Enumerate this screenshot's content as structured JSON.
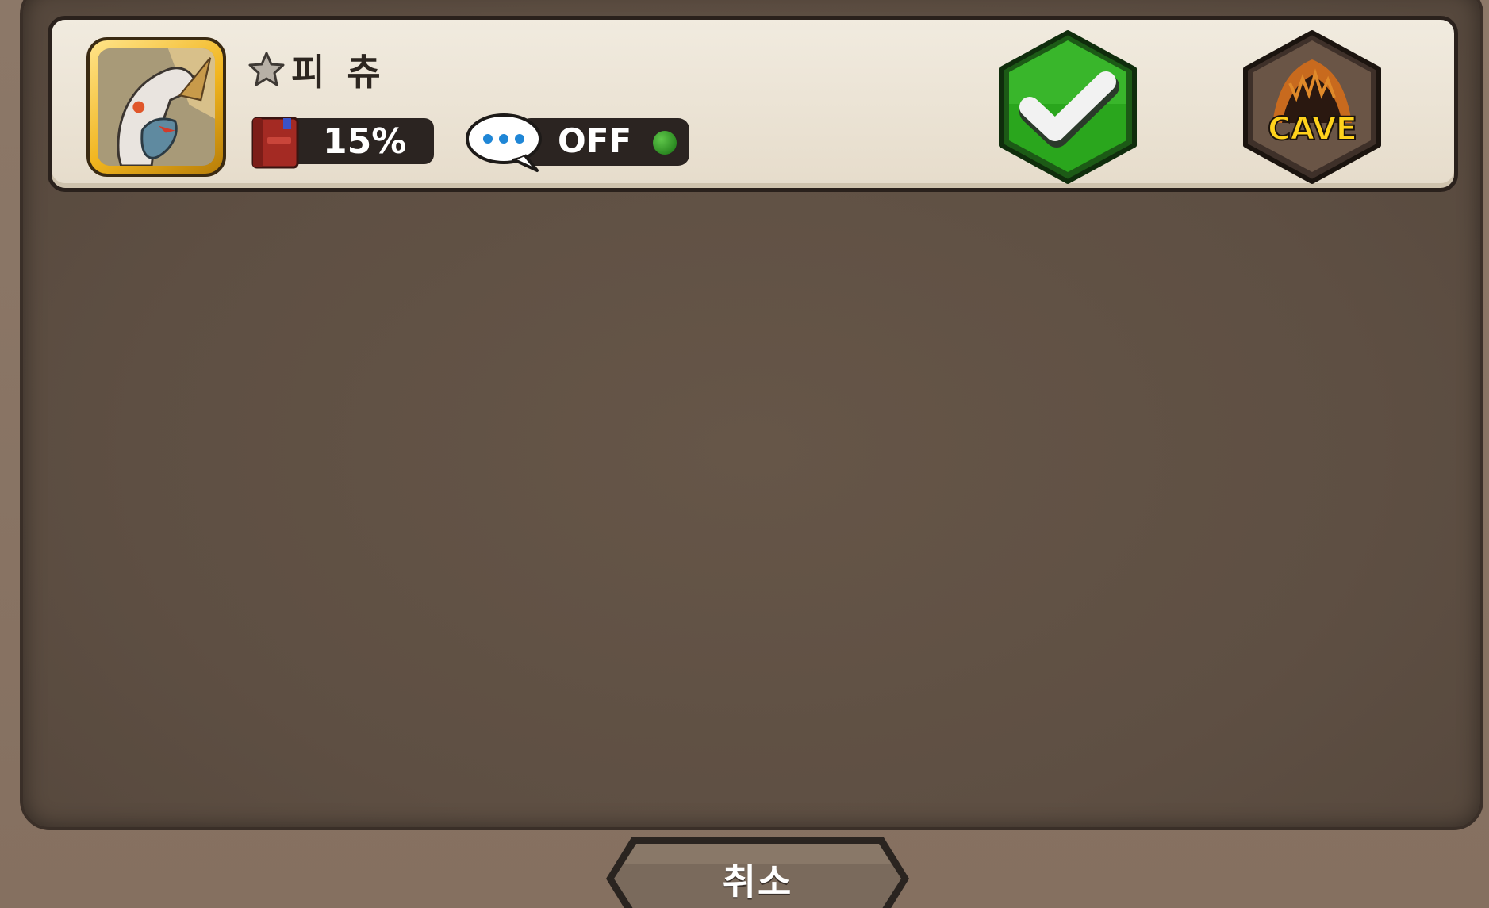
{
  "row": {
    "name": "피 츄",
    "progress_percent": "15%",
    "chat_status": "OFF",
    "cave_label": "CAVE",
    "star_icon": "star-outline-icon",
    "book_icon": "red-book-icon",
    "chat_icon": "speech-bubble-icon",
    "confirm_icon": "checkmark-icon",
    "status_dot_color": "#2c8a22"
  },
  "footer": {
    "cancel_label": "취소"
  },
  "colors": {
    "panel": "#5e4f43",
    "card": "#ece4d5",
    "confirm_green": "#2aa61d",
    "cave_brown": "#6a5546",
    "cave_text": "#ffd21c"
  }
}
